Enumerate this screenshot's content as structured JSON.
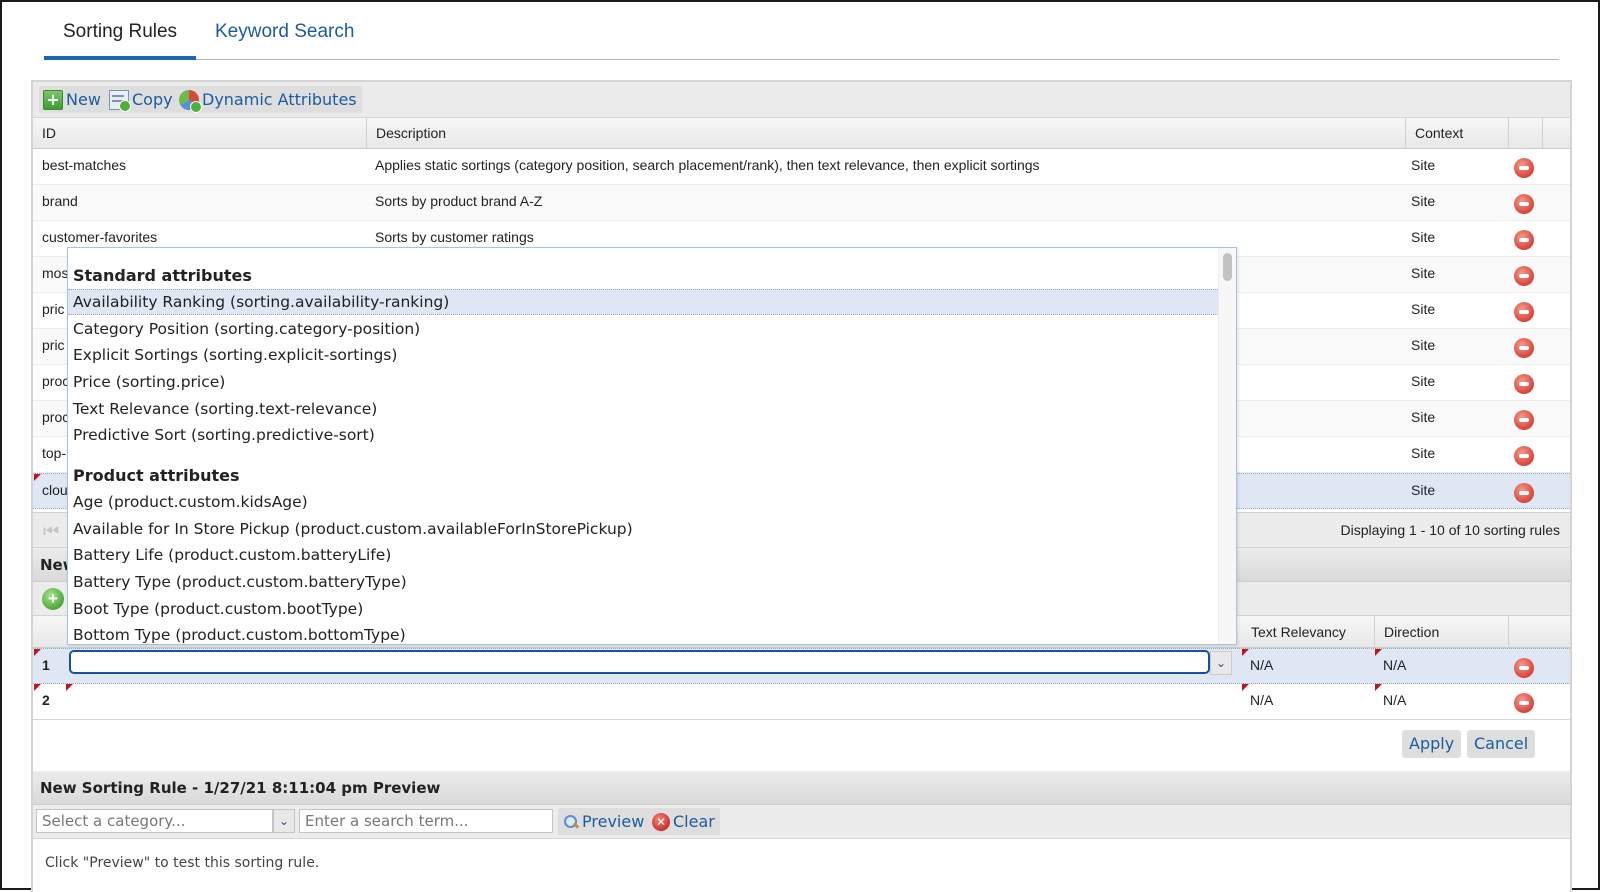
{
  "tabs": [
    {
      "label": "Sorting Rules",
      "active": true
    },
    {
      "label": "Keyword Search",
      "active": false
    }
  ],
  "toolbar": {
    "new_label": "New",
    "copy_label": "Copy",
    "dynamic_label": "Dynamic Attributes"
  },
  "grid": {
    "columns": [
      "ID",
      "Description",
      "Context"
    ],
    "rows": [
      {
        "id": "best-matches",
        "description": "Applies static sortings (category position, search placement/rank), then text relevance, then explicit sortings",
        "context": "Site"
      },
      {
        "id": "brand",
        "description": "Sorts by product brand A-Z",
        "context": "Site"
      },
      {
        "id": "customer-favorites",
        "description": "Sorts by customer ratings",
        "context": "Site"
      },
      {
        "id": "mos",
        "description": "",
        "context": "Site"
      },
      {
        "id": "pric",
        "description": "",
        "context": "Site"
      },
      {
        "id": "pric",
        "description": "",
        "context": "Site"
      },
      {
        "id": "proc",
        "description": "",
        "context": "Site"
      },
      {
        "id": "proc",
        "description": "",
        "context": "Site"
      },
      {
        "id": "top-",
        "description": "",
        "context": "Site"
      },
      {
        "id": "clou",
        "description": "",
        "context": "Site",
        "selected": true
      }
    ],
    "pager_info": "Displaying 1 - 10 of 10 sorting rules"
  },
  "editor": {
    "title": "New",
    "columns": [
      "Text Relevancy",
      "Direction"
    ],
    "rows": [
      {
        "num": "1",
        "attribute": "",
        "text_relevancy": "N/A",
        "direction": "N/A",
        "selected": true
      },
      {
        "num": "2",
        "attribute": "",
        "text_relevancy": "N/A",
        "direction": "N/A",
        "selected": false
      }
    ],
    "apply_label": "Apply",
    "cancel_label": "Cancel"
  },
  "dropdown": {
    "groups": [
      {
        "label": "Standard attributes",
        "items": [
          "Availability Ranking (sorting.availability-ranking)",
          "Category Position (sorting.category-position)",
          "Explicit Sortings (sorting.explicit-sortings)",
          "Price (sorting.price)",
          "Text Relevance (sorting.text-relevance)",
          "Predictive Sort (sorting.predictive-sort)"
        ]
      },
      {
        "label": "Product attributes",
        "items": [
          "Age (product.custom.kidsAge)",
          "Available for In Store Pickup (product.custom.availableForInStorePickup)",
          "Battery Life (product.custom.batteryLife)",
          "Battery Type (product.custom.batteryType)",
          "Boot Type (product.custom.bootType)",
          "Bottom Type (product.custom.bottomType)"
        ]
      }
    ],
    "highlighted": "Availability Ranking (sorting.availability-ranking)"
  },
  "preview": {
    "title": "New Sorting Rule - 1/27/21 8:11:04 pm Preview",
    "category_placeholder": "Select a category...",
    "search_placeholder": "Enter a search term...",
    "preview_label": "Preview",
    "clear_label": "Clear",
    "hint": "Click \"Preview\" to test this sorting rule."
  }
}
